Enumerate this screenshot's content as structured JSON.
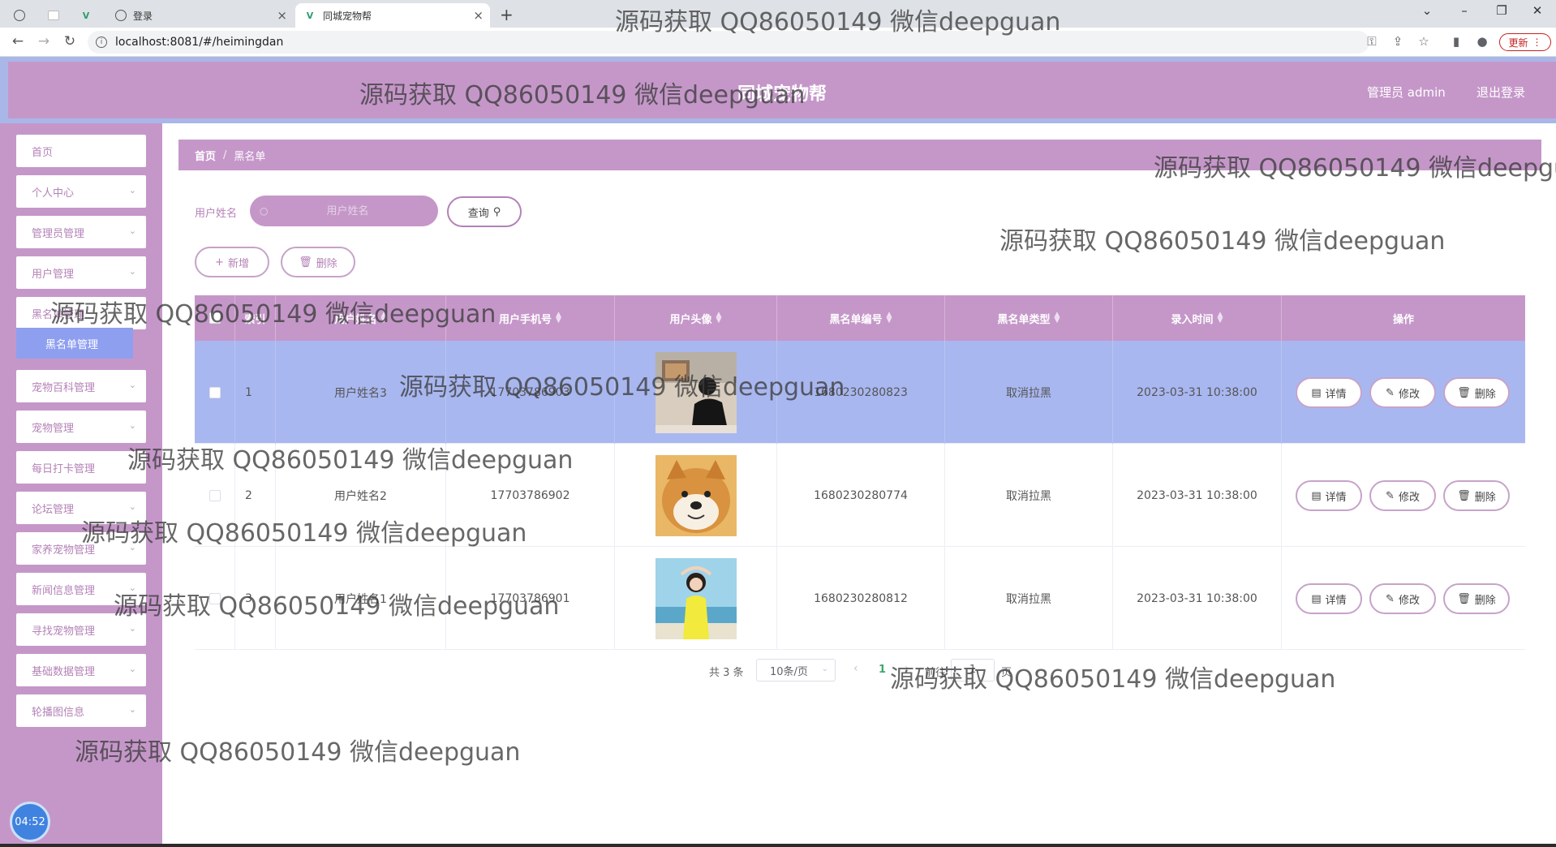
{
  "browser": {
    "tabs": [
      {
        "title": "",
        "icon": "globe-icon",
        "pinned": true
      },
      {
        "title": "",
        "icon": "blank-page-icon",
        "pinned": true
      },
      {
        "title": "",
        "icon": "vue-logo-icon",
        "pinned": true
      },
      {
        "title": "登录",
        "icon": "globe-icon"
      },
      {
        "title": "同城宠物帮",
        "icon": "vue-logo-icon",
        "active": true
      }
    ],
    "url": "localhost:8081/#/heimingdan",
    "update_label": "更新"
  },
  "header": {
    "title": "同城宠物帮",
    "admin_label": "管理员 admin",
    "logout_label": "退出登录"
  },
  "sidebar": {
    "items": [
      {
        "label": "首页"
      },
      {
        "label": "个人中心"
      },
      {
        "label": "管理员管理"
      },
      {
        "label": "用户管理"
      },
      {
        "label": "黑名单管理"
      },
      {
        "label": "宠物百科管理"
      },
      {
        "label": "宠物管理"
      },
      {
        "label": "每日打卡管理"
      },
      {
        "label": "论坛管理"
      },
      {
        "label": "家养宠物管理"
      },
      {
        "label": "新闻信息管理"
      },
      {
        "label": "寻找宠物管理"
      },
      {
        "label": "基础数据管理"
      },
      {
        "label": "轮播图信息"
      }
    ],
    "active_sub_label": "黑名单管理",
    "clock": "04:52"
  },
  "breadcrumb": {
    "home": "首页",
    "current": "黑名单"
  },
  "search": {
    "label": "用户姓名",
    "placeholder": "用户姓名",
    "value": "",
    "query_label": "查询"
  },
  "actions": {
    "add_label": "新增",
    "delete_label": "删除"
  },
  "table": {
    "headers": [
      "索引",
      "用户姓名",
      "用户手机号",
      "用户头像",
      "黑名单编号",
      "黑名单类型",
      "录入时间",
      "操作"
    ],
    "rows": [
      {
        "index": "1",
        "name": "用户姓名3",
        "phone": "17703786903",
        "avatar": "man-in-black-jacket",
        "code": "1680230280823",
        "type": "取消拉黑",
        "time": "2023-03-31 10:38:00",
        "selected": true
      },
      {
        "index": "2",
        "name": "用户姓名2",
        "phone": "17703786902",
        "avatar": "shiba-inu-dog",
        "code": "1680230280774",
        "type": "取消拉黑",
        "time": "2023-03-31 10:38:00",
        "selected": false
      },
      {
        "index": "3",
        "name": "用户姓名1",
        "phone": "17703786901",
        "avatar": "girl-at-beach",
        "code": "1680230280812",
        "type": "取消拉黑",
        "time": "2023-03-31 10:38:00",
        "selected": false
      }
    ],
    "row_actions": {
      "detail": "详情",
      "edit": "修改",
      "delete": "删除"
    }
  },
  "pagination": {
    "total": "共 3 条",
    "page_size": "10条/页",
    "current_page": "1",
    "goto_prefix": "前往",
    "goto_value": "1",
    "goto_suffix": "页"
  },
  "watermark": "源码获取 QQ86050149 微信deepguan",
  "colors": {
    "theme_purple": "#c597c9",
    "header_border_blue": "#a9b7e8",
    "selected_row_blue": "#a9b7f0",
    "submenu_active_blue": "#8f9ff0"
  }
}
